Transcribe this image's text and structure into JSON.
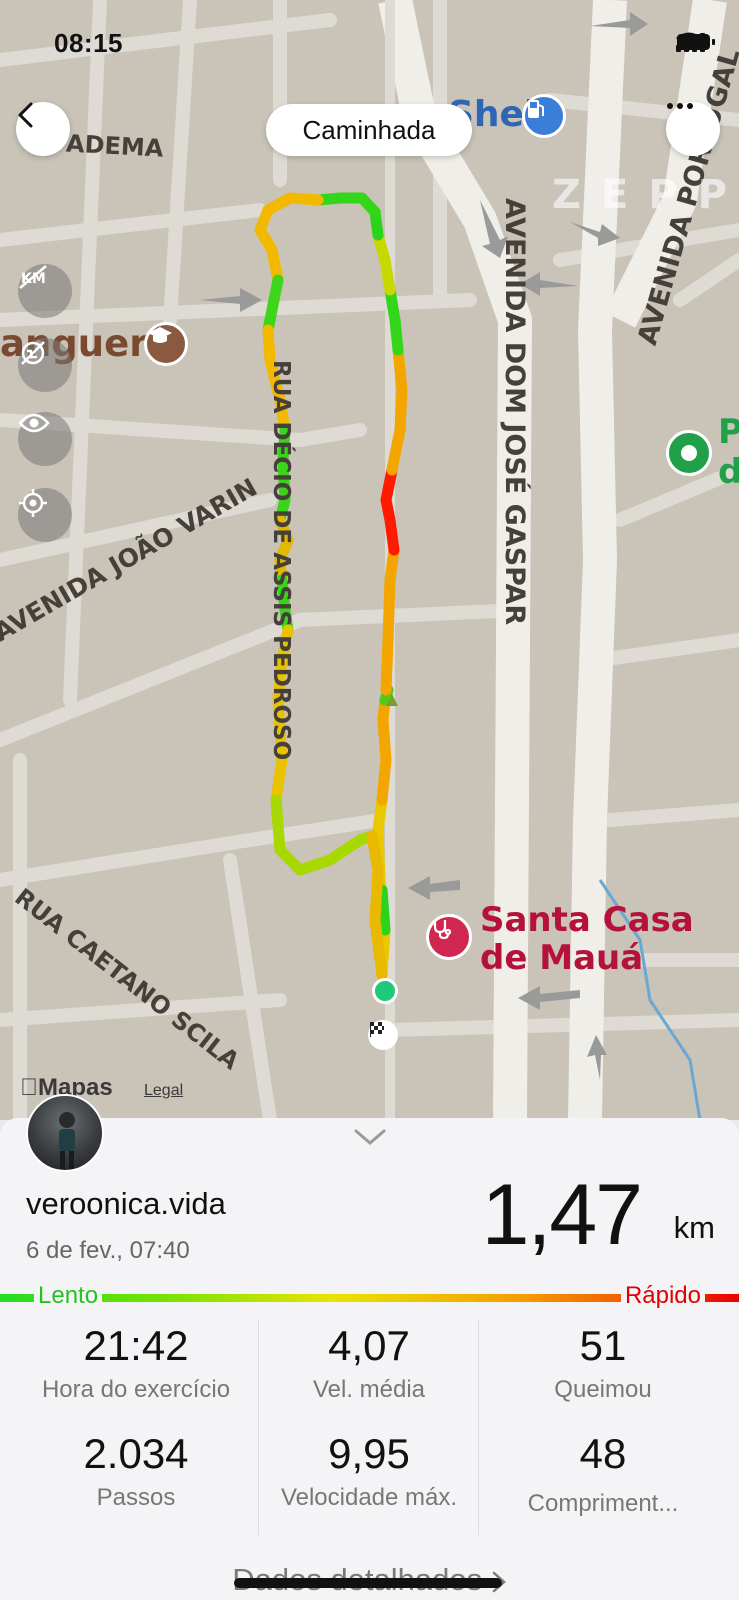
{
  "status_bar": {
    "time": "08:15"
  },
  "header": {
    "activity_title": "Caminhada"
  },
  "map": {
    "streets": [
      "ADEMA",
      "RUA DÉCIO DE ASSIS PEDROSO",
      "AVENIDA JOÃO VARIN",
      "RUA CAETANO SCILA",
      "AVENIDA DOM JOSÉ GASPAR",
      "AVENIDA PORTUGAL"
    ],
    "pois": {
      "shell": "Shell",
      "school": "anguera",
      "hospital_line1": "Santa Casa",
      "hospital_line2": "de Mauá",
      "park_p": "P",
      "park_d": "d"
    },
    "watermark": "ZEPP",
    "attribution": "Mapas",
    "legal": "Legal"
  },
  "colors": {
    "slow": "#22dd22",
    "fast": "#e80000",
    "hospital": "#b4123a",
    "park": "#21a04a"
  },
  "icons": [
    "back-arrow-icon",
    "more-options-icon",
    "km-marker-toggle-icon",
    "hide-route-icon",
    "visibility-icon",
    "locate-icon",
    "shell-fuel-icon",
    "school-icon",
    "hospital-icon",
    "park-icon",
    "start-point-icon",
    "finish-flag-icon",
    "chevron-down-icon",
    "chevron-right-icon"
  ],
  "summary": {
    "username": "veroonica.vida",
    "date": "6 de fev., 07:40",
    "distance_value": "1,47",
    "distance_unit": "km"
  },
  "legend": {
    "slow_label": "Lento",
    "fast_label": "Rápido"
  },
  "stats": [
    {
      "value": "21:42",
      "label": "Hora do exercício"
    },
    {
      "value": "4,07",
      "label": "Vel. média"
    },
    {
      "value": "51",
      "label": "Queimou"
    },
    {
      "value": "2.034",
      "label": "Passos"
    },
    {
      "value": "9,95",
      "label": "Velocidade máx."
    },
    {
      "value": "48",
      "label": "Compriment..."
    }
  ],
  "footer": {
    "details_link": "Dados detalhados"
  }
}
